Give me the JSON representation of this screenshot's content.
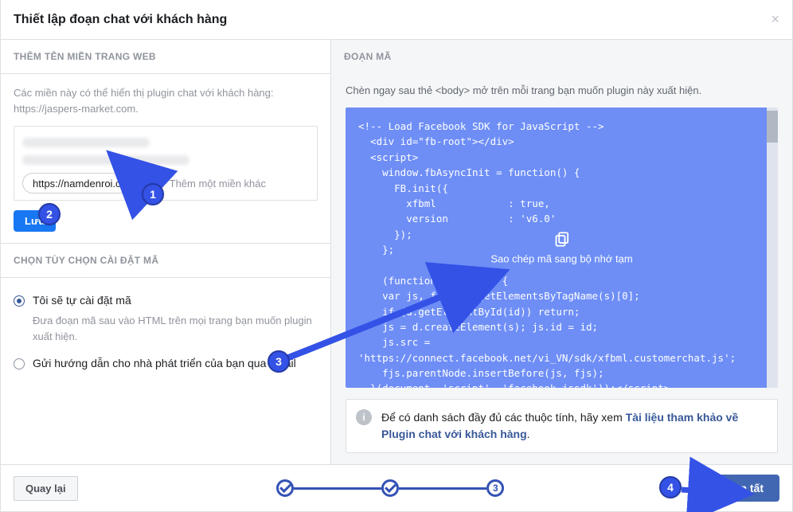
{
  "dialog": {
    "title": "Thiết lập đoạn chat với khách hàng",
    "close": "×"
  },
  "left": {
    "domains_header": "THÊM TÊN MIỀN TRANG WEB",
    "domains_hint_1": "Các miền này có thể hiển thị plugin chat với khách hàng:",
    "domains_hint_2": "https://jaspers-market.com.",
    "chip_domain": "https://namdenroi.com",
    "add_more_placeholder": "Thêm một miền khác",
    "save_label": "Lưu",
    "options_header": "CHỌN TÙY CHỌN CÀI ĐẶT MÃ",
    "opt_self": "Tôi sẽ tự cài đặt mã",
    "opt_self_sub": "Đưa đoạn mã sau vào HTML trên mọi trang bạn muốn plugin xuất hiện.",
    "opt_email": "Gửi hướng dẫn cho nhà phát triển của bạn qua email"
  },
  "right": {
    "header": "ĐOẠN MÃ",
    "note": "Chèn ngay sau thẻ <body> mở trên mỗi trang bạn muốn plugin này xuất hiện.",
    "code": "<!-- Load Facebook SDK for JavaScript -->\n  <div id=\"fb-root\"></div>\n  <script>\n    window.fbAsyncInit = function() {\n      FB.init({\n        xfbml            : true,\n        version          : 'v6.0'\n      });\n    };\n\n    (function(d, s, id) {\n    var js, fjs = d.getElementsByTagName(s)[0];\n    if (d.getElementById(id)) return;\n    js = d.createElement(s); js.id = id;\n    js.src =\n'https://connect.facebook.net/vi_VN/sdk/xfbml.customerchat.js';\n    fjs.parentNode.insertBefore(js, fjs);\n  }(document, 'script', 'facebook-jssdk'));</script>\n\n  <!-- Your customer chat code -->\n  <div class=\"fb-customerchat\"",
    "copy_label": "Sao chép mã sang bộ nhớ tạm",
    "info_prefix": "Để có danh sách đầy đủ các thuộc tính, hãy xem ",
    "info_link": "Tài liệu tham khảo về Plugin chat với khách hàng",
    "info_suffix": "."
  },
  "footer": {
    "back": "Quay lại",
    "step3": "3",
    "done": "Hoàn tất"
  },
  "annotations": {
    "b1": "1",
    "b2": "2",
    "b3": "3",
    "b4": "4"
  }
}
